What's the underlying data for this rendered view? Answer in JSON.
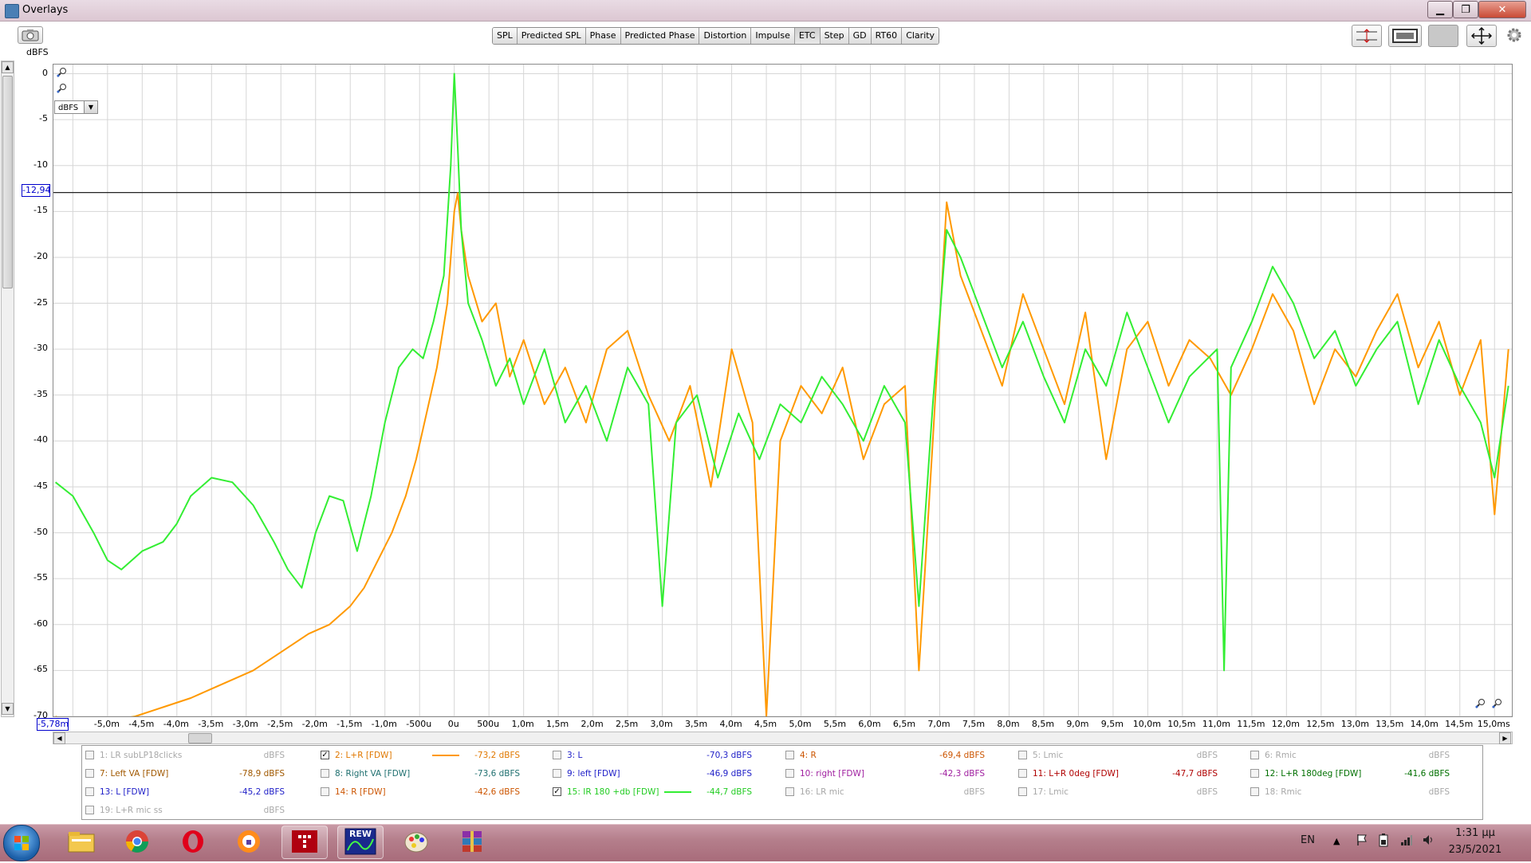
{
  "window": {
    "title": "Overlays",
    "btn_min": "▁",
    "btn_max": "❐",
    "btn_close": "✕"
  },
  "toolbar": {
    "tabs": [
      {
        "label": "SPL"
      },
      {
        "label": "Predicted SPL"
      },
      {
        "label": "Phase"
      },
      {
        "label": "Predicted Phase"
      },
      {
        "label": "Distortion"
      },
      {
        "label": "Impulse"
      },
      {
        "label": "ETC"
      },
      {
        "label": "Step"
      },
      {
        "label": "GD"
      },
      {
        "label": "RT60"
      },
      {
        "label": "Clarity"
      }
    ],
    "active_tab": "ETC"
  },
  "plot": {
    "unit": "dBFS",
    "y_selector": "dBFS",
    "cursor_y": "-12,94",
    "cursor_x": "-5,78m",
    "yticks": [
      "0",
      "-5",
      "-10",
      "-15",
      "-20",
      "-25",
      "-30",
      "-35",
      "-40",
      "-45",
      "-50",
      "-55",
      "-60",
      "-65",
      "-70"
    ],
    "xticks": [
      "-5,0m",
      "-4,5m",
      "-4,0m",
      "-3,5m",
      "-3,0m",
      "-2,5m",
      "-2,0m",
      "-1,5m",
      "-1,0m",
      "-500u",
      "0u",
      "500u",
      "1,0m",
      "1,5m",
      "2,0m",
      "2,5m",
      "3,0m",
      "3,5m",
      "4,0m",
      "4,5m",
      "5,0m",
      "5,5m",
      "6,0m",
      "6,5m",
      "7,0m",
      "7,5m",
      "8,0m",
      "8,5m",
      "9,0m",
      "9,5m",
      "10,0m",
      "10,5m",
      "11,0m",
      "11,5m",
      "12,0m",
      "12,5m",
      "13,0m",
      "13,5m",
      "14,0m",
      "14,5m",
      "15,0ms"
    ]
  },
  "chart_data": {
    "type": "line",
    "xlabel": "",
    "ylabel": "dBFS",
    "xlim": [
      -5.78,
      15.25
    ],
    "ylim": [
      -70,
      1
    ],
    "x_unit": "ms",
    "cursor_y_value": -12.94,
    "grid": true,
    "series": [
      {
        "name": "2: L+R [FDW]",
        "color": "#ff9900",
        "points": [
          [
            -5.75,
            -70
          ],
          [
            -5.5,
            -71
          ],
          [
            -5,
            -70.5
          ],
          [
            -4.6,
            -70
          ],
          [
            -4.2,
            -69
          ],
          [
            -3.8,
            -68
          ],
          [
            -3.5,
            -67
          ],
          [
            -3.2,
            -66
          ],
          [
            -2.9,
            -65
          ],
          [
            -2.5,
            -63
          ],
          [
            -2.1,
            -61
          ],
          [
            -1.8,
            -60
          ],
          [
            -1.5,
            -58
          ],
          [
            -1.3,
            -56
          ],
          [
            -1.1,
            -53
          ],
          [
            -0.9,
            -50
          ],
          [
            -0.7,
            -46
          ],
          [
            -0.55,
            -42
          ],
          [
            -0.4,
            -37
          ],
          [
            -0.25,
            -32
          ],
          [
            -0.1,
            -25
          ],
          [
            0,
            -15
          ],
          [
            0.05,
            -13
          ],
          [
            0.1,
            -17
          ],
          [
            0.2,
            -22
          ],
          [
            0.4,
            -27
          ],
          [
            0.6,
            -25
          ],
          [
            0.8,
            -33
          ],
          [
            1.0,
            -29
          ],
          [
            1.3,
            -36
          ],
          [
            1.6,
            -32
          ],
          [
            1.9,
            -38
          ],
          [
            2.2,
            -30
          ],
          [
            2.5,
            -28
          ],
          [
            2.8,
            -35
          ],
          [
            3.1,
            -40
          ],
          [
            3.4,
            -34
          ],
          [
            3.7,
            -45
          ],
          [
            4.0,
            -30
          ],
          [
            4.3,
            -38
          ],
          [
            4.5,
            -70
          ],
          [
            4.7,
            -40
          ],
          [
            5.0,
            -34
          ],
          [
            5.3,
            -37
          ],
          [
            5.6,
            -32
          ],
          [
            5.9,
            -42
          ],
          [
            6.2,
            -36
          ],
          [
            6.5,
            -34
          ],
          [
            6.7,
            -65
          ],
          [
            6.9,
            -40
          ],
          [
            7.1,
            -14
          ],
          [
            7.3,
            -22
          ],
          [
            7.6,
            -28
          ],
          [
            7.9,
            -34
          ],
          [
            8.2,
            -24
          ],
          [
            8.5,
            -30
          ],
          [
            8.8,
            -36
          ],
          [
            9.1,
            -26
          ],
          [
            9.4,
            -42
          ],
          [
            9.7,
            -30
          ],
          [
            10.0,
            -27
          ],
          [
            10.3,
            -34
          ],
          [
            10.6,
            -29
          ],
          [
            10.9,
            -31
          ],
          [
            11.2,
            -35
          ],
          [
            11.5,
            -30
          ],
          [
            11.8,
            -24
          ],
          [
            12.1,
            -28
          ],
          [
            12.4,
            -36
          ],
          [
            12.7,
            -30
          ],
          [
            13.0,
            -33
          ],
          [
            13.3,
            -28
          ],
          [
            13.6,
            -24
          ],
          [
            13.9,
            -32
          ],
          [
            14.2,
            -27
          ],
          [
            14.5,
            -35
          ],
          [
            14.8,
            -29
          ],
          [
            15.0,
            -48
          ],
          [
            15.2,
            -30
          ]
        ]
      },
      {
        "name": "15: IR 180 +db [FDW]",
        "color": "#33ee33",
        "points": [
          [
            -5.75,
            -44.5
          ],
          [
            -5.5,
            -46
          ],
          [
            -5.2,
            -50
          ],
          [
            -5.0,
            -53
          ],
          [
            -4.8,
            -54
          ],
          [
            -4.5,
            -52
          ],
          [
            -4.2,
            -51
          ],
          [
            -4.0,
            -49
          ],
          [
            -3.8,
            -46
          ],
          [
            -3.5,
            -44
          ],
          [
            -3.2,
            -44.5
          ],
          [
            -2.9,
            -47
          ],
          [
            -2.6,
            -51
          ],
          [
            -2.4,
            -54
          ],
          [
            -2.2,
            -56
          ],
          [
            -2.0,
            -50
          ],
          [
            -1.8,
            -46
          ],
          [
            -1.6,
            -46.5
          ],
          [
            -1.4,
            -52
          ],
          [
            -1.2,
            -46
          ],
          [
            -1.0,
            -38
          ],
          [
            -0.8,
            -32
          ],
          [
            -0.6,
            -30
          ],
          [
            -0.45,
            -31
          ],
          [
            -0.3,
            -27
          ],
          [
            -0.15,
            -22
          ],
          [
            -0.05,
            -10
          ],
          [
            0,
            0
          ],
          [
            0.05,
            -8
          ],
          [
            0.1,
            -17
          ],
          [
            0.2,
            -25
          ],
          [
            0.4,
            -29
          ],
          [
            0.6,
            -34
          ],
          [
            0.8,
            -31
          ],
          [
            1.0,
            -36
          ],
          [
            1.3,
            -30
          ],
          [
            1.6,
            -38
          ],
          [
            1.9,
            -34
          ],
          [
            2.2,
            -40
          ],
          [
            2.5,
            -32
          ],
          [
            2.8,
            -36
          ],
          [
            3.0,
            -58
          ],
          [
            3.2,
            -38
          ],
          [
            3.5,
            -35
          ],
          [
            3.8,
            -44
          ],
          [
            4.1,
            -37
          ],
          [
            4.4,
            -42
          ],
          [
            4.7,
            -36
          ],
          [
            5.0,
            -38
          ],
          [
            5.3,
            -33
          ],
          [
            5.6,
            -36
          ],
          [
            5.9,
            -40
          ],
          [
            6.2,
            -34
          ],
          [
            6.5,
            -38
          ],
          [
            6.7,
            -58
          ],
          [
            6.9,
            -36
          ],
          [
            7.1,
            -17
          ],
          [
            7.3,
            -20
          ],
          [
            7.6,
            -26
          ],
          [
            7.9,
            -32
          ],
          [
            8.2,
            -27
          ],
          [
            8.5,
            -33
          ],
          [
            8.8,
            -38
          ],
          [
            9.1,
            -30
          ],
          [
            9.4,
            -34
          ],
          [
            9.7,
            -26
          ],
          [
            10.0,
            -32
          ],
          [
            10.3,
            -38
          ],
          [
            10.6,
            -33
          ],
          [
            11.0,
            -30
          ],
          [
            11.1,
            -65
          ],
          [
            11.2,
            -32
          ],
          [
            11.5,
            -27
          ],
          [
            11.8,
            -21
          ],
          [
            12.1,
            -25
          ],
          [
            12.4,
            -31
          ],
          [
            12.7,
            -28
          ],
          [
            13.0,
            -34
          ],
          [
            13.3,
            -30
          ],
          [
            13.6,
            -27
          ],
          [
            13.9,
            -36
          ],
          [
            14.2,
            -29
          ],
          [
            14.5,
            -34
          ],
          [
            14.8,
            -38
          ],
          [
            15.0,
            -44
          ],
          [
            15.2,
            -34
          ]
        ]
      }
    ]
  },
  "legend": {
    "items": [
      {
        "label": "1: LR subLP18clicks",
        "value": "dBFS",
        "checked": false,
        "swatch": "",
        "color": "#a8a8a8"
      },
      {
        "label": "2: L+R [FDW]",
        "value": "-73,2 dBFS",
        "checked": true,
        "swatch": "#ff9900",
        "color": "#e07800"
      },
      {
        "label": "3: L",
        "value": "-70,3 dBFS",
        "checked": false,
        "swatch": "",
        "color": "#2020c8"
      },
      {
        "label": "4: R",
        "value": "-69,4 dBFS",
        "checked": false,
        "swatch": "",
        "color": "#cc5500"
      },
      {
        "label": "5: Lmic",
        "value": "dBFS",
        "checked": false,
        "swatch": "",
        "color": "#a8a8a8"
      },
      {
        "label": "6: Rmic",
        "value": "dBFS",
        "checked": false,
        "swatch": "",
        "color": "#a8a8a8"
      },
      {
        "label": "7: Left VA [FDW]",
        "value": "-78,9 dBFS",
        "checked": false,
        "swatch": "",
        "color": "#a05800"
      },
      {
        "label": "8: Right VA [FDW]",
        "value": "-73,6 dBFS",
        "checked": false,
        "swatch": "",
        "color": "#207070"
      },
      {
        "label": "9: left [FDW]",
        "value": "-46,9 dBFS",
        "checked": false,
        "swatch": "",
        "color": "#2020c8"
      },
      {
        "label": "10: right [FDW]",
        "value": "-42,3 dBFS",
        "checked": false,
        "swatch": "",
        "color": "#a020a0"
      },
      {
        "label": "11: L+R 0deg [FDW]",
        "value": "-47,7 dBFS",
        "checked": false,
        "swatch": "",
        "color": "#b00000"
      },
      {
        "label": "12: L+R 180deg [FDW]",
        "value": "-41,6 dBFS",
        "checked": false,
        "swatch": "",
        "color": "#007000"
      },
      {
        "label": "13: L [FDW]",
        "value": "-45,2 dBFS",
        "checked": false,
        "swatch": "",
        "color": "#2020c8"
      },
      {
        "label": "14: R [FDW]",
        "value": "-42,6 dBFS",
        "checked": false,
        "swatch": "",
        "color": "#cc5500"
      },
      {
        "label": "15: IR 180 +db [FDW]",
        "value": "-44,7 dBFS",
        "checked": true,
        "swatch": "#33ee33",
        "color": "#22cc22"
      },
      {
        "label": "16: LR mic",
        "value": "dBFS",
        "checked": false,
        "swatch": "",
        "color": "#a8a8a8"
      },
      {
        "label": "17: Lmic",
        "value": "dBFS",
        "checked": false,
        "swatch": "",
        "color": "#a8a8a8"
      },
      {
        "label": "18: Rmic",
        "value": "dBFS",
        "checked": false,
        "swatch": "",
        "color": "#a8a8a8"
      },
      {
        "label": "19: L+R mic ss",
        "value": "dBFS",
        "checked": false,
        "swatch": "",
        "color": "#a8a8a8"
      }
    ]
  },
  "taskbar": {
    "lang": "EN",
    "time": "1:31 μμ",
    "date": "23/5/2021",
    "apps": [
      {
        "name": "explorer",
        "label": ""
      },
      {
        "name": "chrome",
        "label": ""
      },
      {
        "name": "opera",
        "label": ""
      },
      {
        "name": "avast-browser",
        "label": ""
      },
      {
        "name": "app-red",
        "label": ""
      },
      {
        "name": "rew",
        "label": "REW"
      },
      {
        "name": "paint",
        "label": ""
      },
      {
        "name": "winrar",
        "label": ""
      }
    ]
  },
  "colors": {
    "accent_orange": "#ff9900",
    "accent_green": "#33ee33",
    "cursor_blue": "#0000cc",
    "grid": "#d6d6d6"
  }
}
